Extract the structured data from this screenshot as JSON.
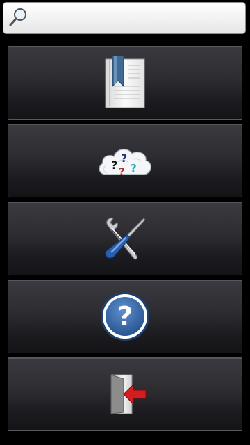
{
  "search": {
    "placeholder": "",
    "value": ""
  },
  "menu": {
    "items": [
      {
        "name": "bookmarks",
        "icon": "bookmark-book-icon"
      },
      {
        "name": "random-question",
        "icon": "question-cloud-icon"
      },
      {
        "name": "settings",
        "icon": "tools-icon"
      },
      {
        "name": "help",
        "icon": "help-icon"
      },
      {
        "name": "exit",
        "icon": "exit-door-icon"
      }
    ]
  },
  "colors": {
    "background": "#000000",
    "button_top": "#3a3a40",
    "button_bottom": "#141417",
    "help_blue": "#2f5f9e",
    "exit_arrow": "#d21e1e"
  }
}
